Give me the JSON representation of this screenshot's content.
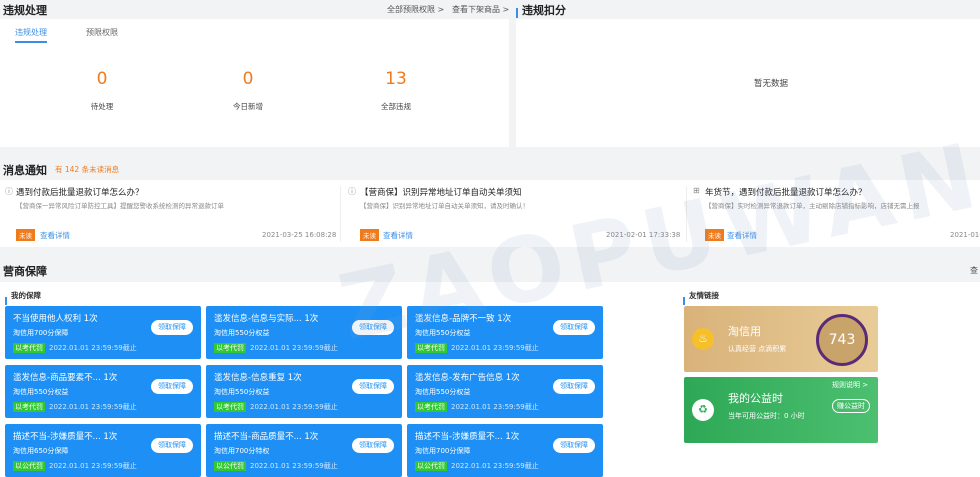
{
  "violation": {
    "title": "违规处理",
    "links": [
      "全部预限权限 >",
      "查看下架商品 >"
    ],
    "tabs": [
      "违规处理",
      "预限权限"
    ],
    "stats": [
      {
        "value": "0",
        "label": "待处理"
      },
      {
        "value": "0",
        "label": "今日新增"
      },
      {
        "value": "13",
        "label": "全部违规"
      }
    ]
  },
  "deduction": {
    "title": "违规扣分",
    "empty": "暂无数据"
  },
  "notice": {
    "title": "消息通知",
    "unread": "有 142 条未读消息",
    "items": [
      {
        "title": "遇到付款后批量退款订单怎么办？",
        "sub": "【营商保一异常风险订单防控工具】提醒您警收系统检测的异常退款订单",
        "badge": "未读",
        "link": "查看详情",
        "date": "2021-03-25 16:08:28"
      },
      {
        "title": "【营商保】识别异常地址订单自动关单须知",
        "sub": "【营商保】识别异常地址订单自动关单须知，请及时确认！",
        "badge": "未读",
        "link": "查看详情",
        "date": "2021-02-01 17:33:38"
      },
      {
        "title": "年货节，遇到付款后批量退款订单怎么办？",
        "sub": "【营商保】实时检测异常退款订单，主动剔除店铺指标影响，店铺无需上报",
        "badge": "未读",
        "link": "查看详情",
        "date": "2021-01-"
      }
    ]
  },
  "guarantee": {
    "title": "营商保障",
    "more": "查",
    "my_title": "我的保障",
    "friend_title": "友情链接",
    "cards": [
      {
        "t1": "不当使用他人权利 1次",
        "t2": "淘信用700分保障",
        "tag": "以考代罚",
        "date": "2022.01.01 23:59:59截止",
        "btn": "领取保障"
      },
      {
        "t1": "滥发信息-信息与实际... 1次",
        "t2": "淘信用550分权益",
        "tag": "以考代罚",
        "date": "2022.01.01 23:59:59截止",
        "btn": "领取保障"
      },
      {
        "t1": "滥发信息-品牌不一致 1次",
        "t2": "淘信用550分权益",
        "tag": "以考代罚",
        "date": "2022.01.01 23:59:59截止",
        "btn": "领取保障"
      },
      {
        "t1": "滥发信息-商品要素不... 1次",
        "t2": "淘信用550分权益",
        "tag": "以考代罚",
        "date": "2022.01.01 23:59:59截止",
        "btn": "领取保障"
      },
      {
        "t1": "滥发信息-信息重复 1次",
        "t2": "淘信用550分权益",
        "tag": "以考代罚",
        "date": "2022.01.01 23:59:59截止",
        "btn": "领取保障"
      },
      {
        "t1": "滥发信息-发布广告信息 1次",
        "t2": "淘信用550分权益",
        "tag": "以考代罚",
        "date": "2022.01.01 23:59:59截止",
        "btn": "领取保障"
      },
      {
        "t1": "描述不当-涉嫌质量不... 1次",
        "t2": "淘信用650分保障",
        "tag": "以公代罚",
        "date": "2022.01.01 23:59:59截止",
        "btn": "领取保障"
      },
      {
        "t1": "描述不当-商品质量不... 1次",
        "t2": "淘信用700分特权",
        "tag": "以公代罚",
        "date": "2022.01.01 23:59:59截止",
        "btn": "领取保障"
      },
      {
        "t1": "描述不当-涉嫌质量不... 1次",
        "t2": "淘信用700分保障",
        "tag": "以公代罚",
        "date": "2022.01.01 23:59:59截止",
        "btn": "领取保障"
      }
    ],
    "taoxinyong": {
      "title": "淘信用",
      "sub": "认真经营 点滴积累",
      "score": "743"
    },
    "gongyi": {
      "title": "我的公益时",
      "rule": "规则说明 >",
      "sub": "当年可用公益时：0 小时",
      "btn": "赚公益时"
    }
  },
  "watermark": "ZAOPUWANG.COM",
  "colors": {
    "accent": "#3a8ee6",
    "orange": "#f07b1d",
    "card_blue": "#1e90f5",
    "tag_green": "#32c832",
    "green_card": "#2ea856"
  }
}
